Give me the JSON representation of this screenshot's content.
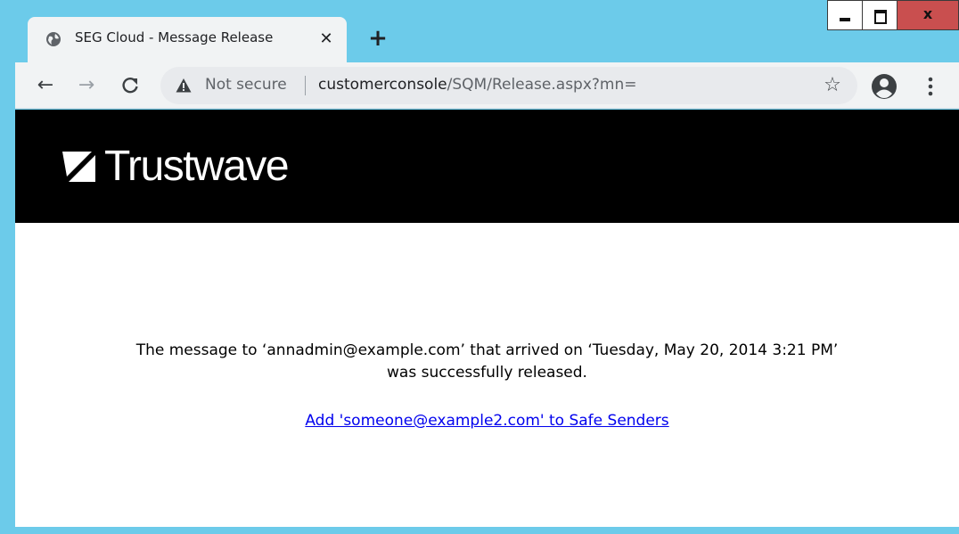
{
  "window": {
    "close_glyph": "x"
  },
  "tab": {
    "title": "SEG Cloud - Message Release",
    "close_glyph": "✕",
    "new_tab_glyph": "+"
  },
  "toolbar": {
    "back_glyph": "←",
    "forward_glyph": "→",
    "reload_glyph": "C",
    "security_label": "Not secure",
    "url_host": "customerconsole",
    "url_path": "/SQM/Release.aspx?mn=",
    "bookmark_glyph": "☆"
  },
  "page": {
    "brand_name": "Trustwave",
    "message_line1": "The message to ‘annadmin@example.com’ that arrived on ‘Tuesday, May 20, 2014 3:21 PM’",
    "message_line2": "was successfully released.",
    "safe_senders_link": "Add 'someone@example2.com' to Safe Senders"
  },
  "colors": {
    "frame": "#6ccbea",
    "header_bg": "#000000",
    "link": "#0000ee",
    "close_button": "#c94f4f"
  },
  "icons": {
    "favicon": "globe-icon",
    "security": "warning-icon",
    "bookmark": "star-icon",
    "profile": "account-circle-icon",
    "menu": "kebab-menu-icon",
    "logo": "trustwave-logo-icon"
  }
}
